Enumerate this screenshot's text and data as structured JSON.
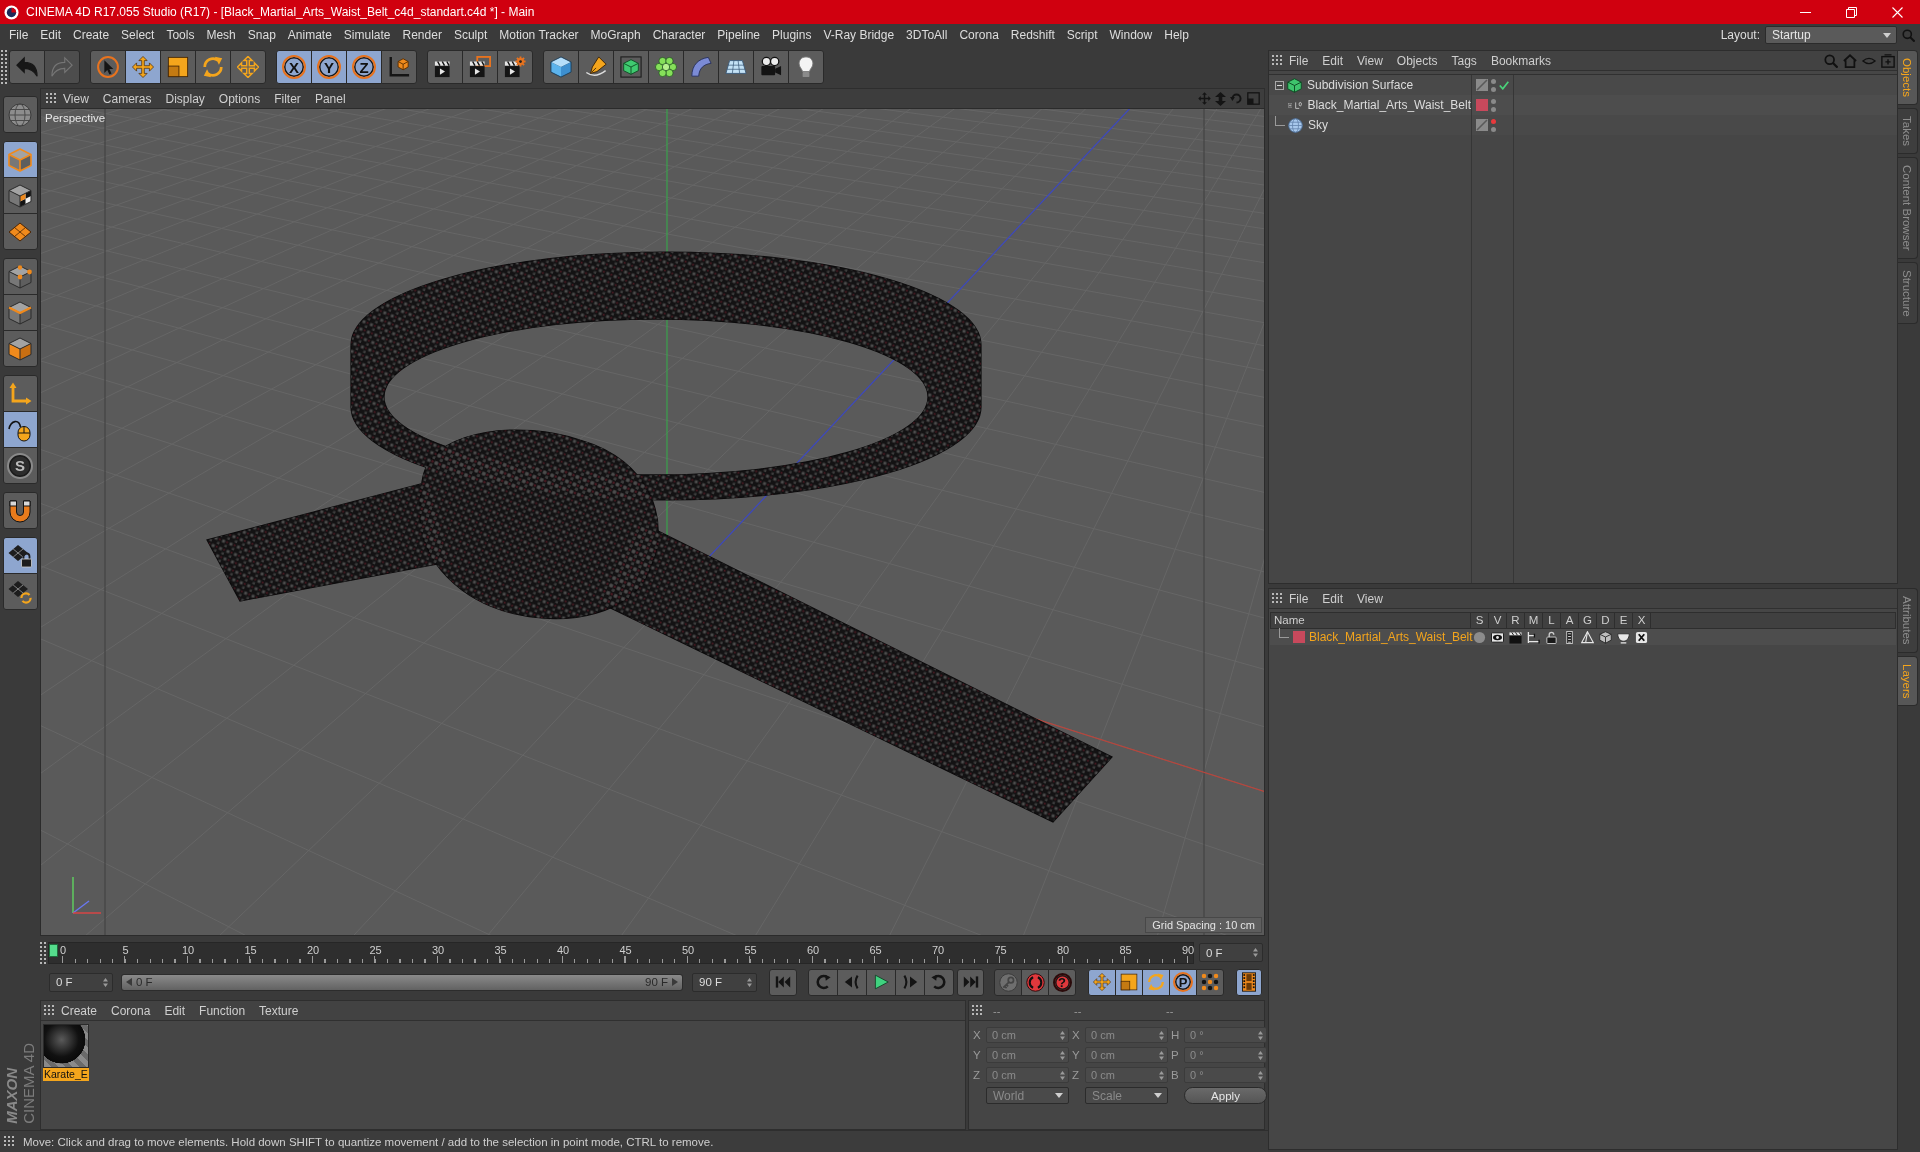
{
  "window": {
    "title": "CINEMA 4D R17.055 Studio (R17) - [Black_Martial_Arts_Waist_Belt_c4d_standart.c4d *] - Main"
  },
  "menu_bar": {
    "items": [
      "File",
      "Edit",
      "Create",
      "Select",
      "Tools",
      "Mesh",
      "Snap",
      "Animate",
      "Simulate",
      "Render",
      "Sculpt",
      "Motion Tracker",
      "MoGraph",
      "Character",
      "Pipeline",
      "Plugins",
      "V-Ray Bridge",
      "3DToAll",
      "Corona",
      "Redshift",
      "Script",
      "Window",
      "Help"
    ],
    "layout_label": "Layout:",
    "layout_value": "Startup"
  },
  "toolbar": {
    "groups": [
      [
        {
          "kind": "undo",
          "selected": false,
          "disabled": false
        },
        {
          "kind": "redo",
          "selected": false,
          "disabled": true
        }
      ],
      [
        {
          "kind": "select",
          "selected": false,
          "disabled": false
        },
        {
          "kind": "move",
          "selected": true,
          "disabled": false
        },
        {
          "kind": "scale",
          "selected": false,
          "disabled": false
        },
        {
          "kind": "rotate",
          "selected": false,
          "disabled": false
        },
        {
          "kind": "transform",
          "selected": false,
          "disabled": false
        }
      ],
      [
        {
          "kind": "axis",
          "label": "X",
          "selected": true,
          "disabled": false
        },
        {
          "kind": "axis",
          "label": "Y",
          "selected": true,
          "disabled": false
        },
        {
          "kind": "axis",
          "label": "Z",
          "selected": true,
          "disabled": false
        },
        {
          "kind": "coordinates",
          "selected": false,
          "disabled": false
        }
      ],
      [
        {
          "kind": "render-view",
          "selected": false,
          "disabled": false
        },
        {
          "kind": "render-picture",
          "selected": false,
          "disabled": false
        },
        {
          "kind": "render-settings",
          "selected": false,
          "disabled": false
        }
      ],
      [
        {
          "kind": "cube",
          "selected": false,
          "disabled": false
        },
        {
          "kind": "pen",
          "selected": false,
          "disabled": false
        },
        {
          "kind": "subdivision",
          "selected": false,
          "disabled": false
        },
        {
          "kind": "cloner",
          "selected": false,
          "disabled": false
        },
        {
          "kind": "bend",
          "selected": false,
          "disabled": false
        },
        {
          "kind": "floor",
          "selected": false,
          "disabled": false
        },
        {
          "kind": "camera",
          "selected": false,
          "disabled": false
        },
        {
          "kind": "light",
          "selected": false,
          "disabled": false
        }
      ]
    ]
  },
  "left_tools": {
    "groups": [
      [
        {
          "kind": "globe",
          "selected": false
        }
      ],
      [
        {
          "kind": "model",
          "selected": true
        },
        {
          "kind": "texture",
          "selected": false
        },
        {
          "kind": "workplane",
          "selected": false
        }
      ],
      [
        {
          "kind": "points",
          "selected": false
        },
        {
          "kind": "edges",
          "selected": false
        },
        {
          "kind": "polygons",
          "selected": false
        }
      ],
      [
        {
          "kind": "axis",
          "selected": false
        },
        {
          "kind": "tweak",
          "selected": true
        },
        {
          "kind": "solo",
          "label": "S",
          "selected": false
        }
      ],
      [
        {
          "kind": "magnet",
          "selected": false
        }
      ],
      [
        {
          "kind": "grid-lock",
          "selected": true
        },
        {
          "kind": "grid-rotate",
          "selected": false
        }
      ]
    ]
  },
  "logo": {
    "brand": "MAXON",
    "product": "CINEMA 4D"
  },
  "viewport": {
    "menu": [
      "View",
      "Cameras",
      "Display",
      "Options",
      "Filter",
      "Panel"
    ],
    "camera": "Perspective",
    "grid_spacing": "Grid Spacing : 10 cm"
  },
  "timeline": {
    "ticks": [
      "0",
      "5",
      "10",
      "15",
      "20",
      "25",
      "30",
      "35",
      "40",
      "45",
      "50",
      "55",
      "60",
      "65",
      "70",
      "75",
      "80",
      "85",
      "90"
    ],
    "playhead": {
      "level": 0
    },
    "current_frame": "0 F",
    "start_frame": "0 F",
    "range": {
      "start": "0 F",
      "end": "90 F",
      "level": 1
    },
    "end_frame": "90 F",
    "transport": [
      {
        "kind": "to-start"
      },
      {
        "kind": "prev-key"
      },
      {
        "kind": "prev-frame"
      },
      {
        "kind": "play"
      },
      {
        "kind": "next-frame"
      },
      {
        "kind": "next-key"
      },
      {
        "kind": "to-end"
      }
    ],
    "record": [
      {
        "kind": "keyframe",
        "disabled": true
      },
      {
        "kind": "autokey",
        "disabled": false
      },
      {
        "kind": "help",
        "label": "?",
        "disabled": false
      }
    ],
    "key_tracks": [
      {
        "kind": "position",
        "selected": true
      },
      {
        "kind": "scale",
        "selected": true
      },
      {
        "kind": "rotation",
        "selected": true
      },
      {
        "kind": "parameter",
        "label": "P",
        "selected": true
      },
      {
        "kind": "point-level",
        "selected": false
      }
    ],
    "timeline_button": {
      "selected": true
    }
  },
  "material_manager": {
    "menu": [
      "Create",
      "Corona",
      "Edit",
      "Function",
      "Texture"
    ],
    "materials": [
      {
        "name": "Karate_E",
        "selected": true
      }
    ]
  },
  "coordinates": {
    "headers": [
      "--",
      "--",
      "--"
    ],
    "rows": [
      [
        {
          "axis": "X",
          "value": "0 cm"
        },
        {
          "axis": "X",
          "value": "0 cm"
        },
        {
          "axis": "H",
          "value": "0 °"
        }
      ],
      [
        {
          "axis": "Y",
          "value": "0 cm"
        },
        {
          "axis": "Y",
          "value": "0 cm"
        },
        {
          "axis": "P",
          "value": "0 °"
        }
      ],
      [
        {
          "axis": "Z",
          "value": "0 cm"
        },
        {
          "axis": "Z",
          "value": "0 cm"
        },
        {
          "axis": "B",
          "value": "0 °"
        }
      ]
    ],
    "dropdowns": [
      "World",
      "Scale"
    ],
    "apply": "Apply"
  },
  "status_bar": {
    "text": "Move: Click and drag to move elements. Hold down SHIFT to quantize movement / add to the selection in point mode, CTRL to remove."
  },
  "object_manager": {
    "menu": [
      "File",
      "Edit",
      "View",
      "Objects",
      "Tags",
      "Bookmarks"
    ],
    "objects": [
      {
        "name": "Subdivision Surface",
        "kind": "subdivision",
        "expanded": true,
        "enabled": true,
        "editor_hidden": false,
        "selected": false,
        "children": [
          {
            "name": "Black_Martial_Arts_Waist_Belt",
            "kind": "polygon",
            "expanded": false,
            "color": "#c8495c",
            "editor_hidden": false,
            "selected": false
          }
        ]
      },
      {
        "name": "Sky",
        "kind": "sky",
        "editor_hidden": true,
        "selected": false
      }
    ]
  },
  "layer_manager": {
    "menu": [
      "File",
      "Edit",
      "View"
    ],
    "columns": [
      {
        "label": "Name",
        "kind": "name"
      },
      {
        "label": "S",
        "kind": "solo"
      },
      {
        "label": "V",
        "kind": "view"
      },
      {
        "label": "R",
        "kind": "render"
      },
      {
        "label": "M",
        "kind": "manager"
      },
      {
        "label": "L",
        "kind": "lock"
      },
      {
        "label": "A",
        "kind": "animation"
      },
      {
        "label": "G",
        "kind": "generators"
      },
      {
        "label": "D",
        "kind": "deformers"
      },
      {
        "label": "E",
        "kind": "expressions"
      },
      {
        "label": "X",
        "kind": "xrefs"
      }
    ],
    "layers": [
      {
        "name": "Black_Martial_Arts_Waist_Belt",
        "color": "#c8495c",
        "selected": true
      }
    ]
  },
  "side_tabs": {
    "top": [
      {
        "label": "Objects",
        "selected": true
      },
      {
        "label": "Takes",
        "selected": false
      },
      {
        "label": "Content Browser",
        "selected": false
      },
      {
        "label": "Structure",
        "selected": false
      }
    ],
    "bottom": [
      {
        "label": "Attributes",
        "selected": false
      },
      {
        "label": "Layers",
        "selected": true
      }
    ]
  }
}
